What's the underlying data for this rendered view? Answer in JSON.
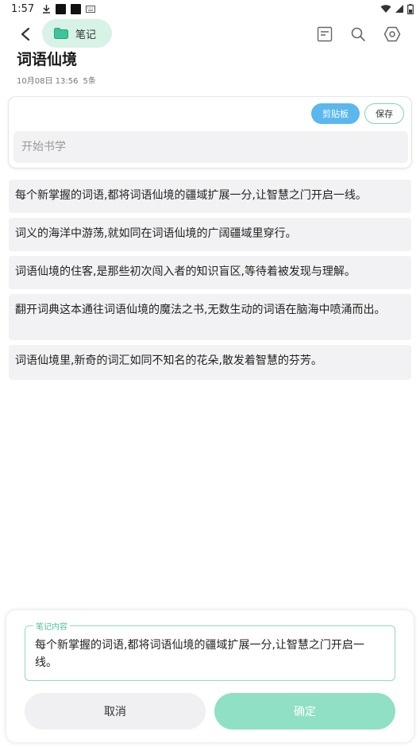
{
  "status_bar": {
    "time": "1:57"
  },
  "header": {
    "folder_label": "笔记"
  },
  "page": {
    "title": "词语仙境",
    "date": "10月08日 13:56",
    "count": "5条"
  },
  "input_card": {
    "clipboard_label": "剪贴板",
    "save_label": "保存",
    "placeholder": "开始书学"
  },
  "items": [
    {
      "text": "每个新掌握的词语,都将词语仙境的疆域扩展一分,让智慧之门开启一线。"
    },
    {
      "text": "词义的海洋中游荡,就如同在词语仙境的广阔疆域里穿行。"
    },
    {
      "text": "词语仙境的住客,是那些初次闯入者的知识盲区,等待着被发现与理解。"
    },
    {
      "text": "翻开词典这本通往词语仙境的魔法之书,无数生动的词语在脑海中喷涌而出。"
    },
    {
      "text": "词语仙境里,新奇的词汇如同不知名的花朵,散发着智慧的芬芳。"
    }
  ],
  "sheet": {
    "field_label": "笔记内容",
    "field_value": "每个新掌握的词语,都将词语仙境的疆域扩展一分,让智慧之门开启一线。",
    "cancel_label": "取消",
    "confirm_label": "确定"
  },
  "colors": {
    "accent_green": "#8fe0c4",
    "clipboard_blue": "#5bb8ee",
    "chip_green": "#d7f2e7"
  },
  "icons": [
    "download-icon",
    "wifi-icon",
    "signal-icon",
    "battery-icon",
    "back-arrow-icon",
    "folder-icon",
    "note-icon",
    "search-icon",
    "settings-icon"
  ]
}
